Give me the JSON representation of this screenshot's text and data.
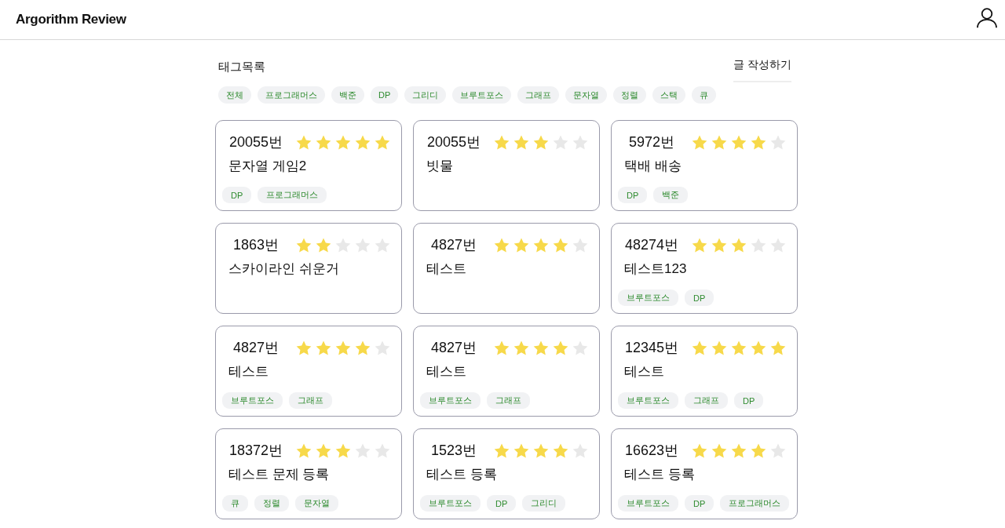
{
  "header": {
    "title": "Argorithm Review"
  },
  "tag_list": {
    "heading": "태그목록",
    "write_link": "글 작성하기",
    "tags": [
      "전체",
      "프로그래머스",
      "백준",
      "DP",
      "그리디",
      "브루트포스",
      "그래프",
      "문자열",
      "정렬",
      "스택",
      "큐"
    ]
  },
  "cards": [
    {
      "number": "20055번",
      "stars": 5,
      "title": "문자열 게임2",
      "tags": [
        "DP",
        "프로그래머스"
      ]
    },
    {
      "number": "20055번",
      "stars": 3,
      "title": "빗물"
    },
    {
      "number": "5972번",
      "stars": 4,
      "title": "택배 배송",
      "tags": [
        "DP",
        "백준"
      ]
    },
    {
      "number": "1863번",
      "stars": 2,
      "title": "스카이라인 쉬운거"
    },
    {
      "number": "4827번",
      "stars": 4,
      "title": "테스트"
    },
    {
      "number": "48274번",
      "stars": 3,
      "title": "테스트123",
      "tags": [
        "브루트포스",
        "DP"
      ]
    },
    {
      "number": "4827번",
      "stars": 4,
      "title": "테스트",
      "tags": [
        "브루트포스",
        "그래프"
      ]
    },
    {
      "number": "4827번",
      "stars": 4,
      "title": "테스트",
      "tags": [
        "브루트포스",
        "그래프"
      ]
    },
    {
      "number": "12345번",
      "stars": 5,
      "title": "테스트",
      "tags": [
        "브루트포스",
        "그래프",
        "DP"
      ]
    },
    {
      "number": "18372번",
      "stars": 3,
      "title": "테스트 문제 등록",
      "tags": [
        "큐",
        "정렬",
        "문자열"
      ]
    },
    {
      "number": "1523번",
      "stars": 4,
      "title": "테스트 등록",
      "tags": [
        "브루트포스",
        "DP",
        "그리디"
      ]
    },
    {
      "number": "16623번",
      "stars": 4,
      "title": "테스트 등록",
      "tags": [
        "브루트포스",
        "DP",
        "프로그래머스"
      ]
    }
  ]
}
